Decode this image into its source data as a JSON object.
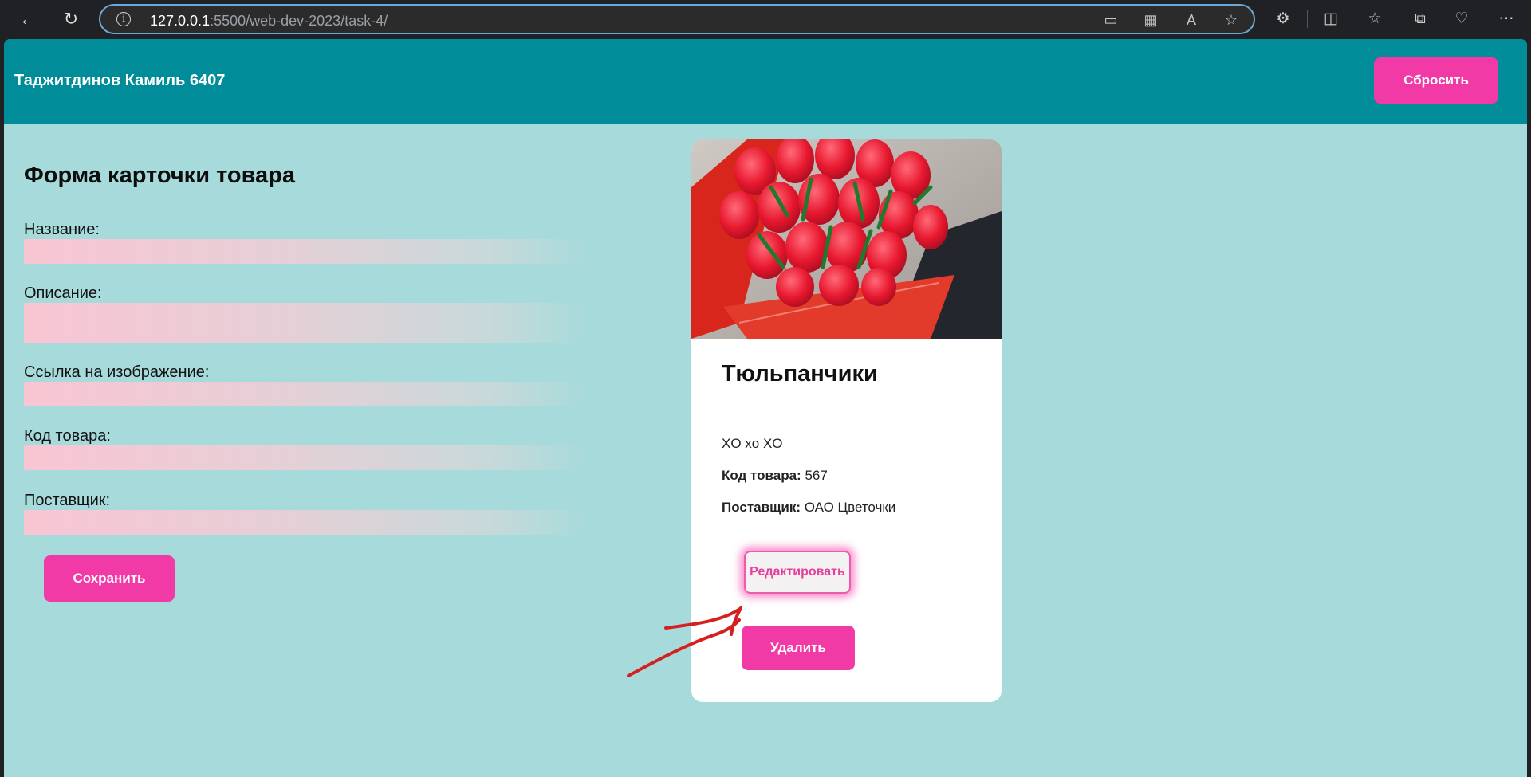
{
  "browser": {
    "url_host": "127.0.0.1",
    "url_rest": ":5500/web-dev-2023/task-4/"
  },
  "header": {
    "title": "Таджитдинов Камиль 6407",
    "reset_label": "Сбросить"
  },
  "form": {
    "title": "Форма карточки товара",
    "fields": [
      {
        "label": "Название:",
        "value": ""
      },
      {
        "label": "Описание:",
        "value": ""
      },
      {
        "label": "Ссылка на изображение:",
        "value": ""
      },
      {
        "label": "Код товара:",
        "value": ""
      },
      {
        "label": "Поставщик:",
        "value": ""
      }
    ],
    "save_label": "Сохранить"
  },
  "card": {
    "title": "Тюльпанчики",
    "description": "XO xo XO",
    "code_label": "Код товара:",
    "code_value": "567",
    "supplier_label": "Поставщик:",
    "supplier_value": "ОАО Цветочки",
    "edit_label": "Редактировать",
    "delete_label": "Удалить"
  },
  "colors": {
    "header_bg": "#008c99",
    "page_bg": "#a6dadb",
    "accent": "#f23aa6",
    "annotation": "#d42020"
  }
}
